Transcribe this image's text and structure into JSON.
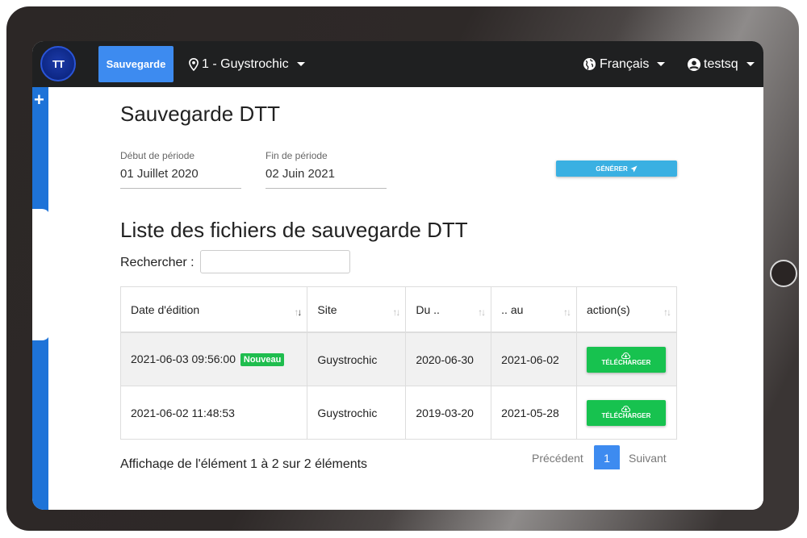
{
  "navbar": {
    "logo_text": "TT",
    "active_label": "Sauvegarde",
    "site_label": "1 - Guystrochic",
    "language_label": "Français",
    "user_label": "testsq"
  },
  "sidebar": {
    "add_symbol": "+"
  },
  "page": {
    "title": "Sauvegarde DTT",
    "period_start_label": "Début de période",
    "period_start_value": "01 Juillet 2020",
    "period_end_label": "Fin de période",
    "period_end_value": "02 Juin 2021",
    "generate_label": "GÉNÉRER"
  },
  "list": {
    "title": "Liste des fichiers de sauvegarde DTT",
    "search_label": "Rechercher :",
    "search_value": "",
    "columns": [
      "Date d'édition",
      "Site",
      "Du ..",
      ".. au",
      "action(s)"
    ],
    "rows": [
      {
        "date": "2021-06-03 09:56:00",
        "badge": "Nouveau",
        "site": "Guystrochic",
        "from": "2020-06-30",
        "to": "2021-06-02",
        "action": "TÉLÉCHARGER"
      },
      {
        "date": "2021-06-02 11:48:53",
        "badge": "",
        "site": "Guystrochic",
        "from": "2019-03-20",
        "to": "2021-05-28",
        "action": "TÉLÉCHARGER"
      }
    ],
    "info": "Affichage de l'élément 1 à 2 sur 2 éléments",
    "pagination": {
      "previous": "Précédent",
      "current_page": "1",
      "next": "Suivant"
    }
  },
  "colors": {
    "accent_blue": "#3d8bf0",
    "sidebar_blue": "#1e73d8",
    "generate": "#3ab0e2",
    "download_green": "#17c24f",
    "navbar": "#1f2021"
  }
}
